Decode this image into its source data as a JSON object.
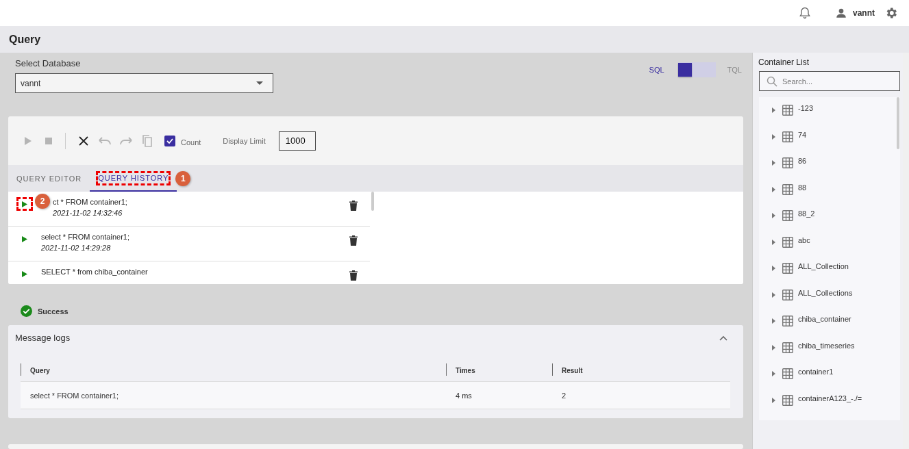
{
  "header": {
    "user": "vannt"
  },
  "page_title": "Query",
  "database": {
    "label": "Select Database",
    "value": "vannt"
  },
  "language_toggle": [
    {
      "label": "SQL",
      "selected": true
    },
    {
      "label": "TQL",
      "selected": false
    }
  ],
  "toolbar": {
    "tools": [
      {
        "kind": "run",
        "disabled": true
      },
      {
        "kind": "stop",
        "disabled": true
      },
      {
        "kind": "clear",
        "disabled": false
      },
      {
        "kind": "undo",
        "disabled": true
      },
      {
        "kind": "redo",
        "disabled": true
      },
      {
        "kind": "copy",
        "disabled": true
      }
    ],
    "count": {
      "label": "Count",
      "checked": true
    },
    "display_limit": {
      "label": "Display Limit",
      "value": "1000"
    }
  },
  "tabs": [
    {
      "label": "QUERY EDITOR",
      "selected": false
    },
    {
      "label": "QUERY HISTORY",
      "selected": true,
      "callout": "1"
    }
  ],
  "history": [
    {
      "query": "ct * FROM container1;",
      "time": "2021-11-02 14:32:46",
      "callout": "2"
    },
    {
      "query": "select * FROM container1;",
      "time": "2021-11-02 14:29:28"
    },
    {
      "query": "SELECT * from chiba_container"
    }
  ],
  "status": "Success",
  "message_logs": {
    "title": "Message logs",
    "expanded": true,
    "columns": [
      "Query",
      "Times",
      "Result"
    ],
    "rows": [
      [
        "select * FROM container1;",
        "4 ms",
        "2"
      ]
    ]
  },
  "container_list": {
    "title": "Container List",
    "search_placeholder": "Search...",
    "items": [
      "-123",
      "74",
      "86",
      "88",
      "88_2",
      "abc",
      "ALL_Collection",
      "ALL_Collections",
      "chiba_container",
      "chiba_timeseries",
      "container1",
      "containerA123_-./="
    ]
  }
}
